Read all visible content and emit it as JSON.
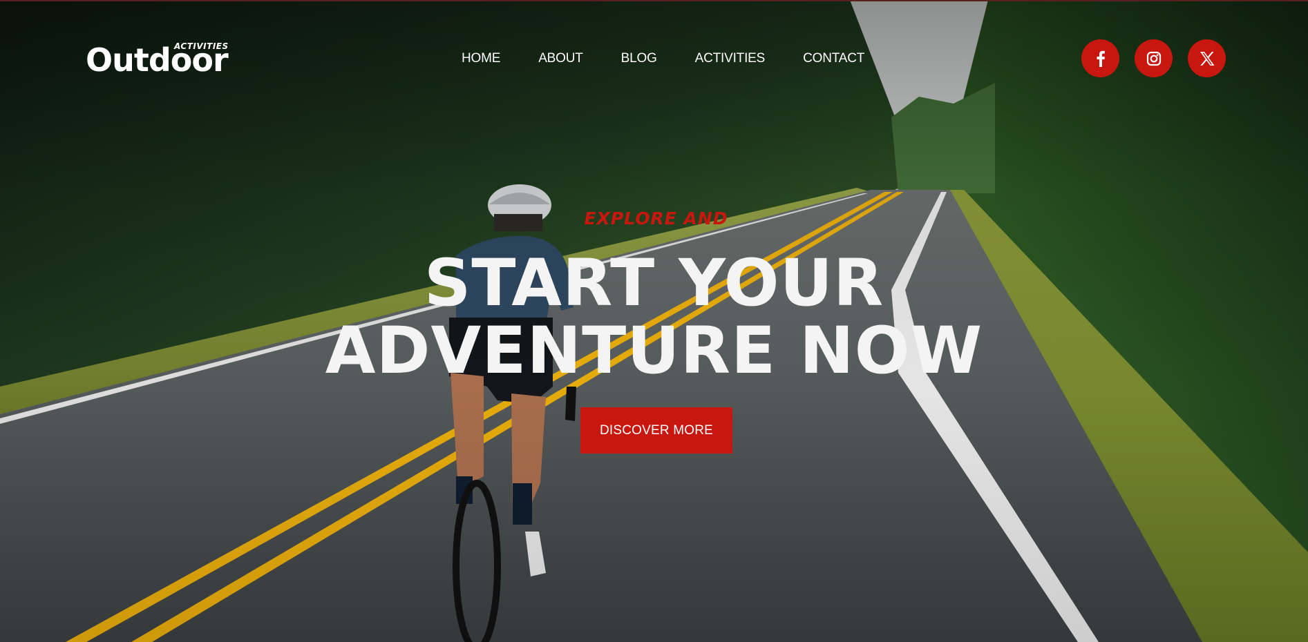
{
  "brand": {
    "logo_main": "Outdoor",
    "logo_sub": "ACTIVITIES"
  },
  "nav": {
    "items": [
      {
        "label": "HOME"
      },
      {
        "label": "ABOUT"
      },
      {
        "label": "BLOG"
      },
      {
        "label": "ACTIVITIES"
      },
      {
        "label": "CONTACT"
      }
    ]
  },
  "socials": {
    "items": [
      {
        "icon": "facebook-icon"
      },
      {
        "icon": "instagram-icon"
      },
      {
        "icon": "x-twitter-icon"
      }
    ]
  },
  "hero": {
    "eyebrow": "EXPLORE AND",
    "headline_line1": "START YOUR",
    "headline_line2": "ADVENTURE NOW",
    "cta_label": "DISCOVER MORE",
    "background_image": "cyclist riding on a forest road"
  },
  "colors": {
    "accent": "#c7170f",
    "text": "#ffffff"
  }
}
